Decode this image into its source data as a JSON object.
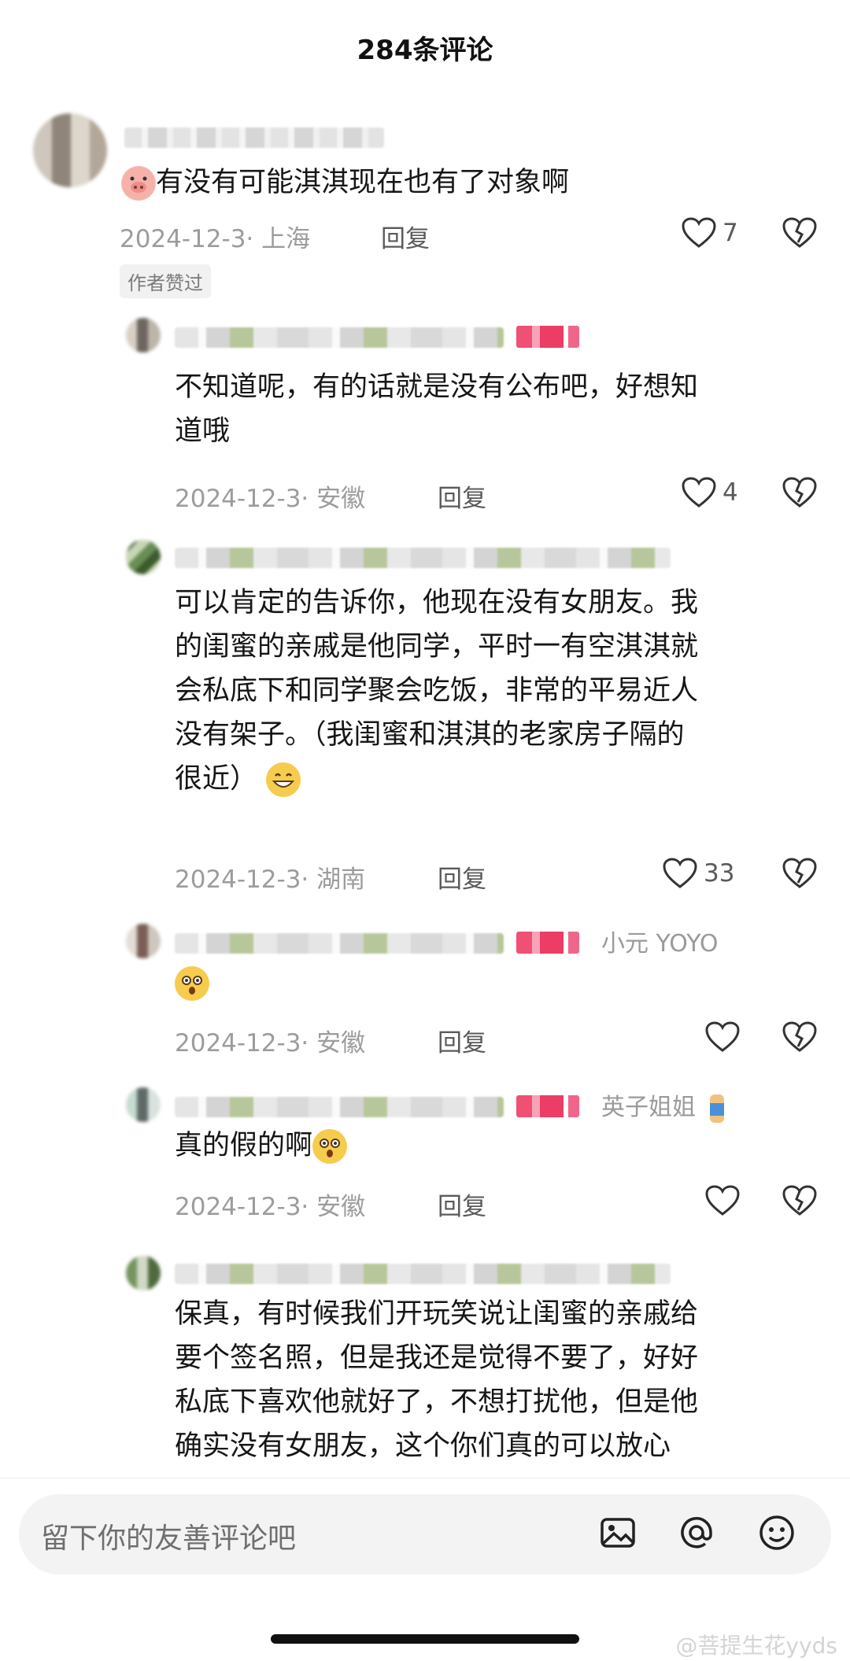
{
  "header": {
    "title": "284条评论"
  },
  "comments": [
    {
      "text": "有没有可能淇淇现在也有了对象啊",
      "date_loc": "2024-12-3· 上海",
      "reply_label": "回复",
      "likes": "7",
      "author_tag": "作者赞过",
      "avatar_icon": "avatar-blurred"
    },
    {
      "text_lines": [
        "不知道呢，有的话就是没有公布吧，好想知",
        "道哦"
      ],
      "date_loc": "2024-12-3· 安徽",
      "reply_label": "回复",
      "likes": "4"
    },
    {
      "text_lines": [
        "可以肯定的告诉你，他现在没有女朋友。我",
        "的闺蜜的亲戚是他同学，平时一有空淇淇就",
        "会私底下和同学聚会吃饭，非常的平易近人",
        "没有架子。（我闺蜜和淇淇的老家房子隔的",
        "很近）"
      ],
      "date_loc": "2024-12-3· 湖南",
      "reply_label": "回复",
      "likes": "33",
      "trailing_emoji": "grin-emoji"
    },
    {
      "reply_to": "小元 YOYO",
      "emoji": "dizzy-face-emoji",
      "date_loc": "2024-12-3· 安徽",
      "reply_label": "回复",
      "likes": ""
    },
    {
      "reply_to": "英子姐姐",
      "text": "真的假的啊",
      "date_loc": "2024-12-3· 安徽",
      "reply_label": "回复",
      "likes": ""
    },
    {
      "text_lines": [
        "保真，有时候我们开玩笑说让闺蜜的亲戚给",
        "要个签名照，但是我还是觉得不要了，好好",
        "私底下喜欢他就好了，不想打扰他，但是他",
        "确实没有女朋友，这个你们真的可以放心"
      ]
    }
  ],
  "composer": {
    "placeholder": "留下你的友善评论吧",
    "icons": [
      "image-icon",
      "at-icon",
      "emoji-icon"
    ]
  },
  "watermark": "@菩提生花yyds"
}
